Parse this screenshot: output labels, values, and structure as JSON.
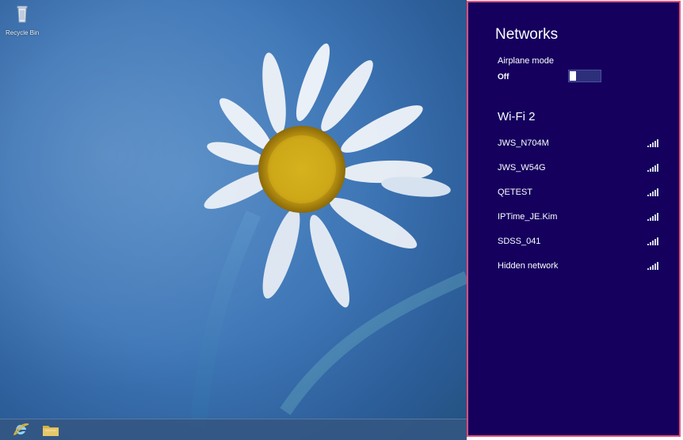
{
  "desktop": {
    "recycle_bin_label": "Recycle Bin",
    "taskbar": {
      "icons": [
        {
          "name": "internet-explorer-icon"
        },
        {
          "name": "file-explorer-icon"
        }
      ]
    }
  },
  "networks_panel": {
    "title": "Networks",
    "airplane_mode": {
      "label": "Airplane mode",
      "value": "Off"
    },
    "section_title": "Wi-Fi 2",
    "networks": [
      {
        "name": "JWS_N704M",
        "icon": "wifi-signal-icon"
      },
      {
        "name": "JWS_W54G",
        "icon": "wifi-signal-icon"
      },
      {
        "name": "QETEST",
        "icon": "wifi-signal-icon"
      },
      {
        "name": "IPTime_JE.Kim",
        "icon": "wifi-signal-icon"
      },
      {
        "name": "SDSS_041",
        "icon": "wifi-signal-icon"
      },
      {
        "name": "Hidden network",
        "icon": "wifi-signal-icon"
      }
    ]
  },
  "colors": {
    "panel_background": "#15005e",
    "panel_border": "#e94c79",
    "text": "#ffffff"
  }
}
